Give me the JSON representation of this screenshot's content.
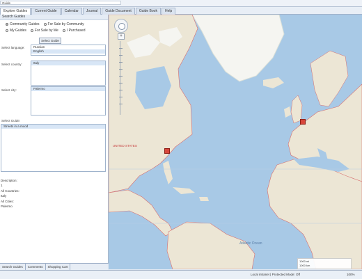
{
  "window": {
    "title": "Guide"
  },
  "tabs": [
    {
      "label": "Explore Guides"
    },
    {
      "label": "Current Guide"
    },
    {
      "label": "Calendar"
    },
    {
      "label": "Journal"
    },
    {
      "label": "Guide Document"
    },
    {
      "label": "Guide Book"
    },
    {
      "label": "Help"
    }
  ],
  "panel": {
    "title": "Search Guides",
    "radios": [
      {
        "label": "Community Guides",
        "checked": true
      },
      {
        "label": "For Sale by Community",
        "checked": false
      },
      {
        "label": "My Guides",
        "checked": false
      },
      {
        "label": "For Sale by Me",
        "checked": false
      },
      {
        "label": "I Purchased",
        "checked": false
      }
    ],
    "select_button": "Select Guide",
    "language_label": "Select language:",
    "languages": [
      "Russian",
      "English"
    ],
    "country_label": "Select country:",
    "countries": [
      "Italy"
    ],
    "city_label": "Select city:",
    "cities": [
      "Palermo"
    ],
    "guide_label": "Select Guide:",
    "guides": [
      "Streets in a mood"
    ],
    "description_label": "Description:",
    "description_value": "1",
    "countries_info_label": "All Countries:",
    "countries_info_value": "Italy",
    "cities_info_label": "All Cities:",
    "cities_info_value": "Palermo"
  },
  "bottom_tabs": [
    "Search Guides",
    "Comments",
    "Shopping Cart"
  ],
  "map": {
    "labels": {
      "us": "UNITED STATES",
      "atlantic": "Atlantic Ocean"
    },
    "colors": {
      "water": "#a8c9e6",
      "land": "#ece6d5",
      "ice": "#f5f5f1",
      "border": "#d76f6f",
      "marker": "#d7463b"
    }
  },
  "statusbar": {
    "zone": "Local intranet | Protected Mode: Off",
    "zoom": "100%",
    "scale1": "1000 mi",
    "scale2": "1000 km"
  }
}
